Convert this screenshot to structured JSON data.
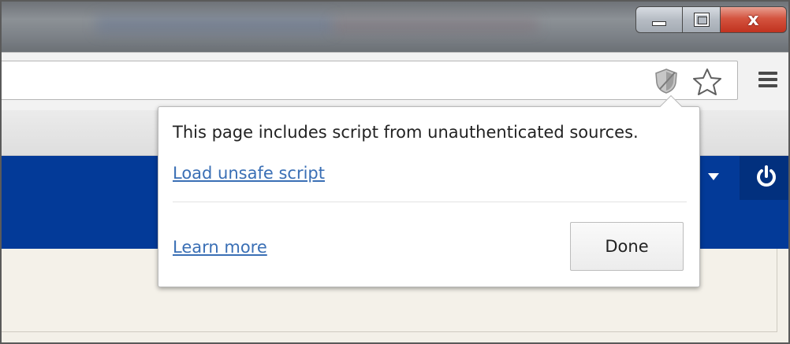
{
  "window": {
    "controls": {
      "minimize_icon": "minimize-icon",
      "maximize_icon": "restore-icon",
      "close_icon": "close-icon",
      "close_glyph": "x"
    }
  },
  "toolbar": {
    "omnibox_icons": [
      "shield-icon",
      "star-icon"
    ],
    "menu_icon": "hamburger-menu-icon"
  },
  "page": {
    "header_color": "#033a98",
    "header_icons": [
      "dropdown-arrow-icon",
      "power-icon"
    ]
  },
  "bubble": {
    "message": "This page includes script from unauthenticated sources.",
    "load_unsafe_link": "Load unsafe script",
    "learn_more_link": "Learn more",
    "done_button": "Done",
    "link_color": "#3a6fb5"
  }
}
